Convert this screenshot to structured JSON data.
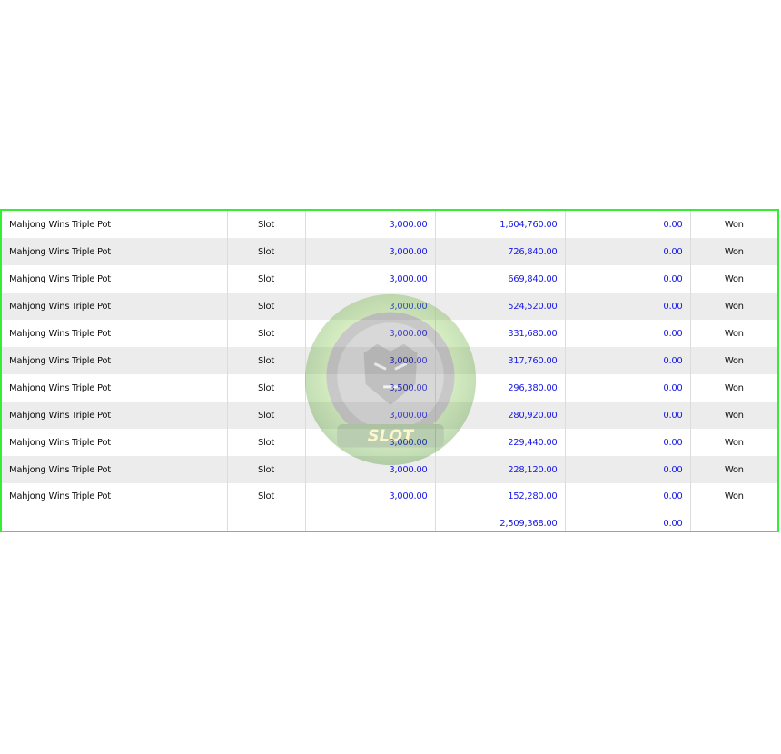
{
  "colors": {
    "frame_border": "#33ee33",
    "amount_text": "#1a1ae6",
    "stripe_row": "#ececec"
  },
  "rows": [
    {
      "game": "Mahjong Wins Triple Pot",
      "type": "Slot",
      "bet": "3,000.00",
      "win": "1,604,760.00",
      "profit": "0.00",
      "status": "Won"
    },
    {
      "game": "Mahjong Wins Triple Pot",
      "type": "Slot",
      "bet": "3,000.00",
      "win": "726,840.00",
      "profit": "0.00",
      "status": "Won"
    },
    {
      "game": "Mahjong Wins Triple Pot",
      "type": "Slot",
      "bet": "3,000.00",
      "win": "669,840.00",
      "profit": "0.00",
      "status": "Won"
    },
    {
      "game": "Mahjong Wins Triple Pot",
      "type": "Slot",
      "bet": "3,000.00",
      "win": "524,520.00",
      "profit": "0.00",
      "status": "Won"
    },
    {
      "game": "Mahjong Wins Triple Pot",
      "type": "Slot",
      "bet": "3,000.00",
      "win": "331,680.00",
      "profit": "0.00",
      "status": "Won"
    },
    {
      "game": "Mahjong Wins Triple Pot",
      "type": "Slot",
      "bet": "3,000.00",
      "win": "317,760.00",
      "profit": "0.00",
      "status": "Won"
    },
    {
      "game": "Mahjong Wins Triple Pot",
      "type": "Slot",
      "bet": "3,500.00",
      "win": "296,380.00",
      "profit": "0.00",
      "status": "Won"
    },
    {
      "game": "Mahjong Wins Triple Pot",
      "type": "Slot",
      "bet": "3,000.00",
      "win": "280,920.00",
      "profit": "0.00",
      "status": "Won"
    },
    {
      "game": "Mahjong Wins Triple Pot",
      "type": "Slot",
      "bet": "3,000.00",
      "win": "229,440.00",
      "profit": "0.00",
      "status": "Won"
    },
    {
      "game": "Mahjong Wins Triple Pot",
      "type": "Slot",
      "bet": "3,000.00",
      "win": "228,120.00",
      "profit": "0.00",
      "status": "Won"
    },
    {
      "game": "Mahjong Wins Triple Pot",
      "type": "Slot",
      "bet": "3,000.00",
      "win": "152,280.00",
      "profit": "0.00",
      "status": "Won"
    }
  ],
  "totals": {
    "win": "2,509,368.00",
    "profit": "0.00"
  },
  "watermark": {
    "text": "SLOT",
    "icon": "tiger-emblem-icon"
  }
}
